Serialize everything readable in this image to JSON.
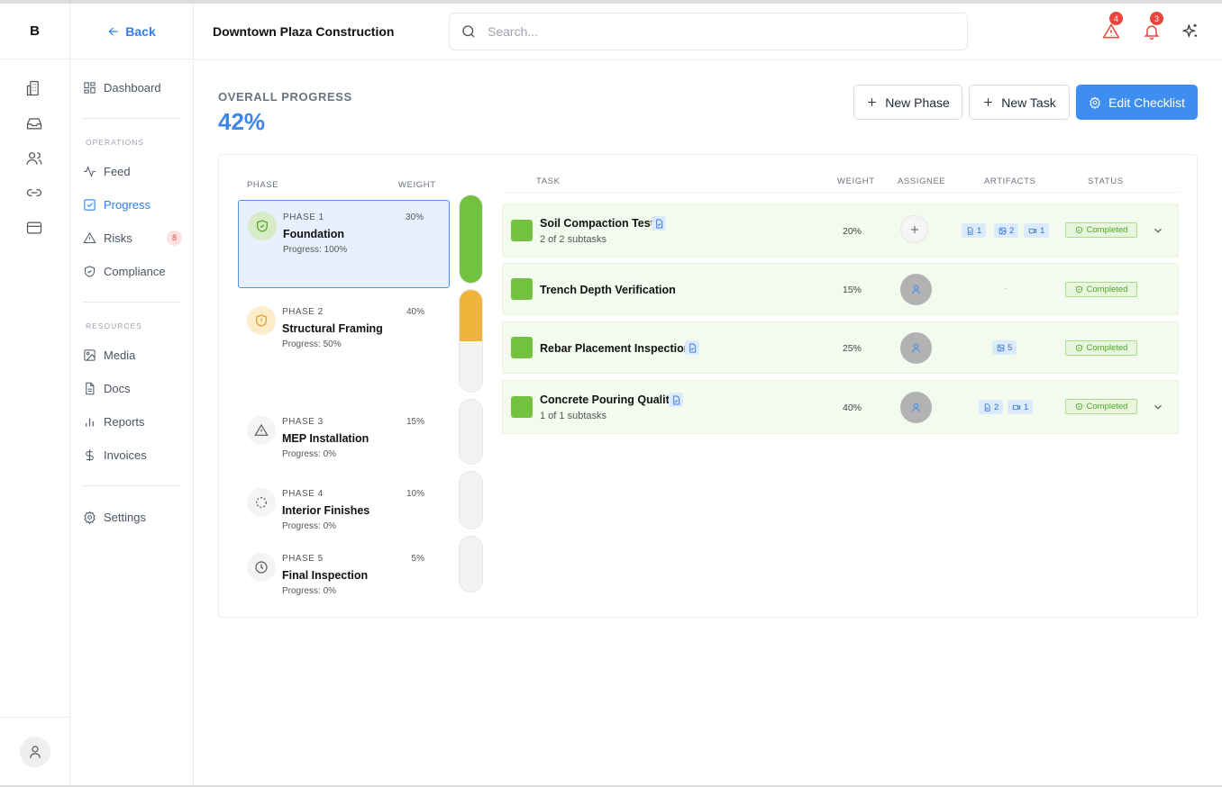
{
  "app": {
    "logo": "B",
    "back_label": "Back",
    "project_title": "Downtown Plaza Construction"
  },
  "search": {
    "placeholder": "Search..."
  },
  "header": {
    "alerts_count": "4",
    "notifications_count": "3"
  },
  "nav": {
    "dashboard": "Dashboard",
    "operations_title": "OPERATIONS",
    "feed": "Feed",
    "progress": "Progress",
    "risks": "Risks",
    "risks_badge": "8",
    "compliance": "Compliance",
    "resources_title": "RESOURCES",
    "media": "Media",
    "docs": "Docs",
    "reports": "Reports",
    "invoices": "Invoices",
    "settings": "Settings"
  },
  "overall": {
    "label": "OVERALL PROGRESS",
    "value": "42%"
  },
  "actions": {
    "new_phase": "New Phase",
    "new_task": "New Task",
    "edit_checklist": "Edit Checklist"
  },
  "phase_table": {
    "col_phase": "PHASE",
    "col_weight": "WEIGHT"
  },
  "phases": [
    {
      "num": "PHASE 1",
      "name": "Foundation",
      "progress": "Progress: 100%",
      "weight": "30%",
      "fill": 1.0,
      "color": "#72c23f"
    },
    {
      "num": "PHASE 2",
      "name": "Structural Framing",
      "progress": "Progress: 50%",
      "weight": "40%",
      "fill": 0.5,
      "color": "#f0b33c"
    },
    {
      "num": "PHASE 3",
      "name": "MEP Installation",
      "progress": "Progress: 0%",
      "weight": "15%",
      "fill": 0,
      "color": "#9ca3af"
    },
    {
      "num": "PHASE 4",
      "name": "Interior Finishes",
      "progress": "Progress: 0%",
      "weight": "10%",
      "fill": 0,
      "color": "#9ca3af"
    },
    {
      "num": "PHASE 5",
      "name": "Final Inspection",
      "progress": "Progress: 0%",
      "weight": "5%",
      "fill": 0,
      "color": "#9ca3af"
    }
  ],
  "task_table": {
    "col_task": "TASK",
    "col_weight": "WEIGHT",
    "col_assignee": "ASSIGNEE",
    "col_artifacts": "ARTIFACTS",
    "col_status": "STATUS"
  },
  "tasks": [
    {
      "name": "Soil Compaction Test",
      "subtasks": "2 of 2 subtasks",
      "weight": "20%",
      "status": "Completed",
      "artifacts": {
        "docs": "1",
        "images": "2",
        "videos": "1"
      }
    },
    {
      "name": "Trench Depth Verification",
      "weight": "15%",
      "status": "Completed",
      "artifacts": {
        "empty": "-"
      }
    },
    {
      "name": "Rebar Placement Inspection",
      "weight": "25%",
      "status": "Completed",
      "artifacts": {
        "images": "5"
      }
    },
    {
      "name": "Concrete Pouring Quality",
      "subtasks": "1 of 1 subtasks",
      "weight": "40%",
      "status": "Completed",
      "artifacts": {
        "docs": "2",
        "videos": "1"
      }
    }
  ],
  "colors": {
    "accent": "#3e8ef2",
    "success": "#72c23f",
    "warning": "#f0b33c",
    "danger": "#e8453c"
  }
}
